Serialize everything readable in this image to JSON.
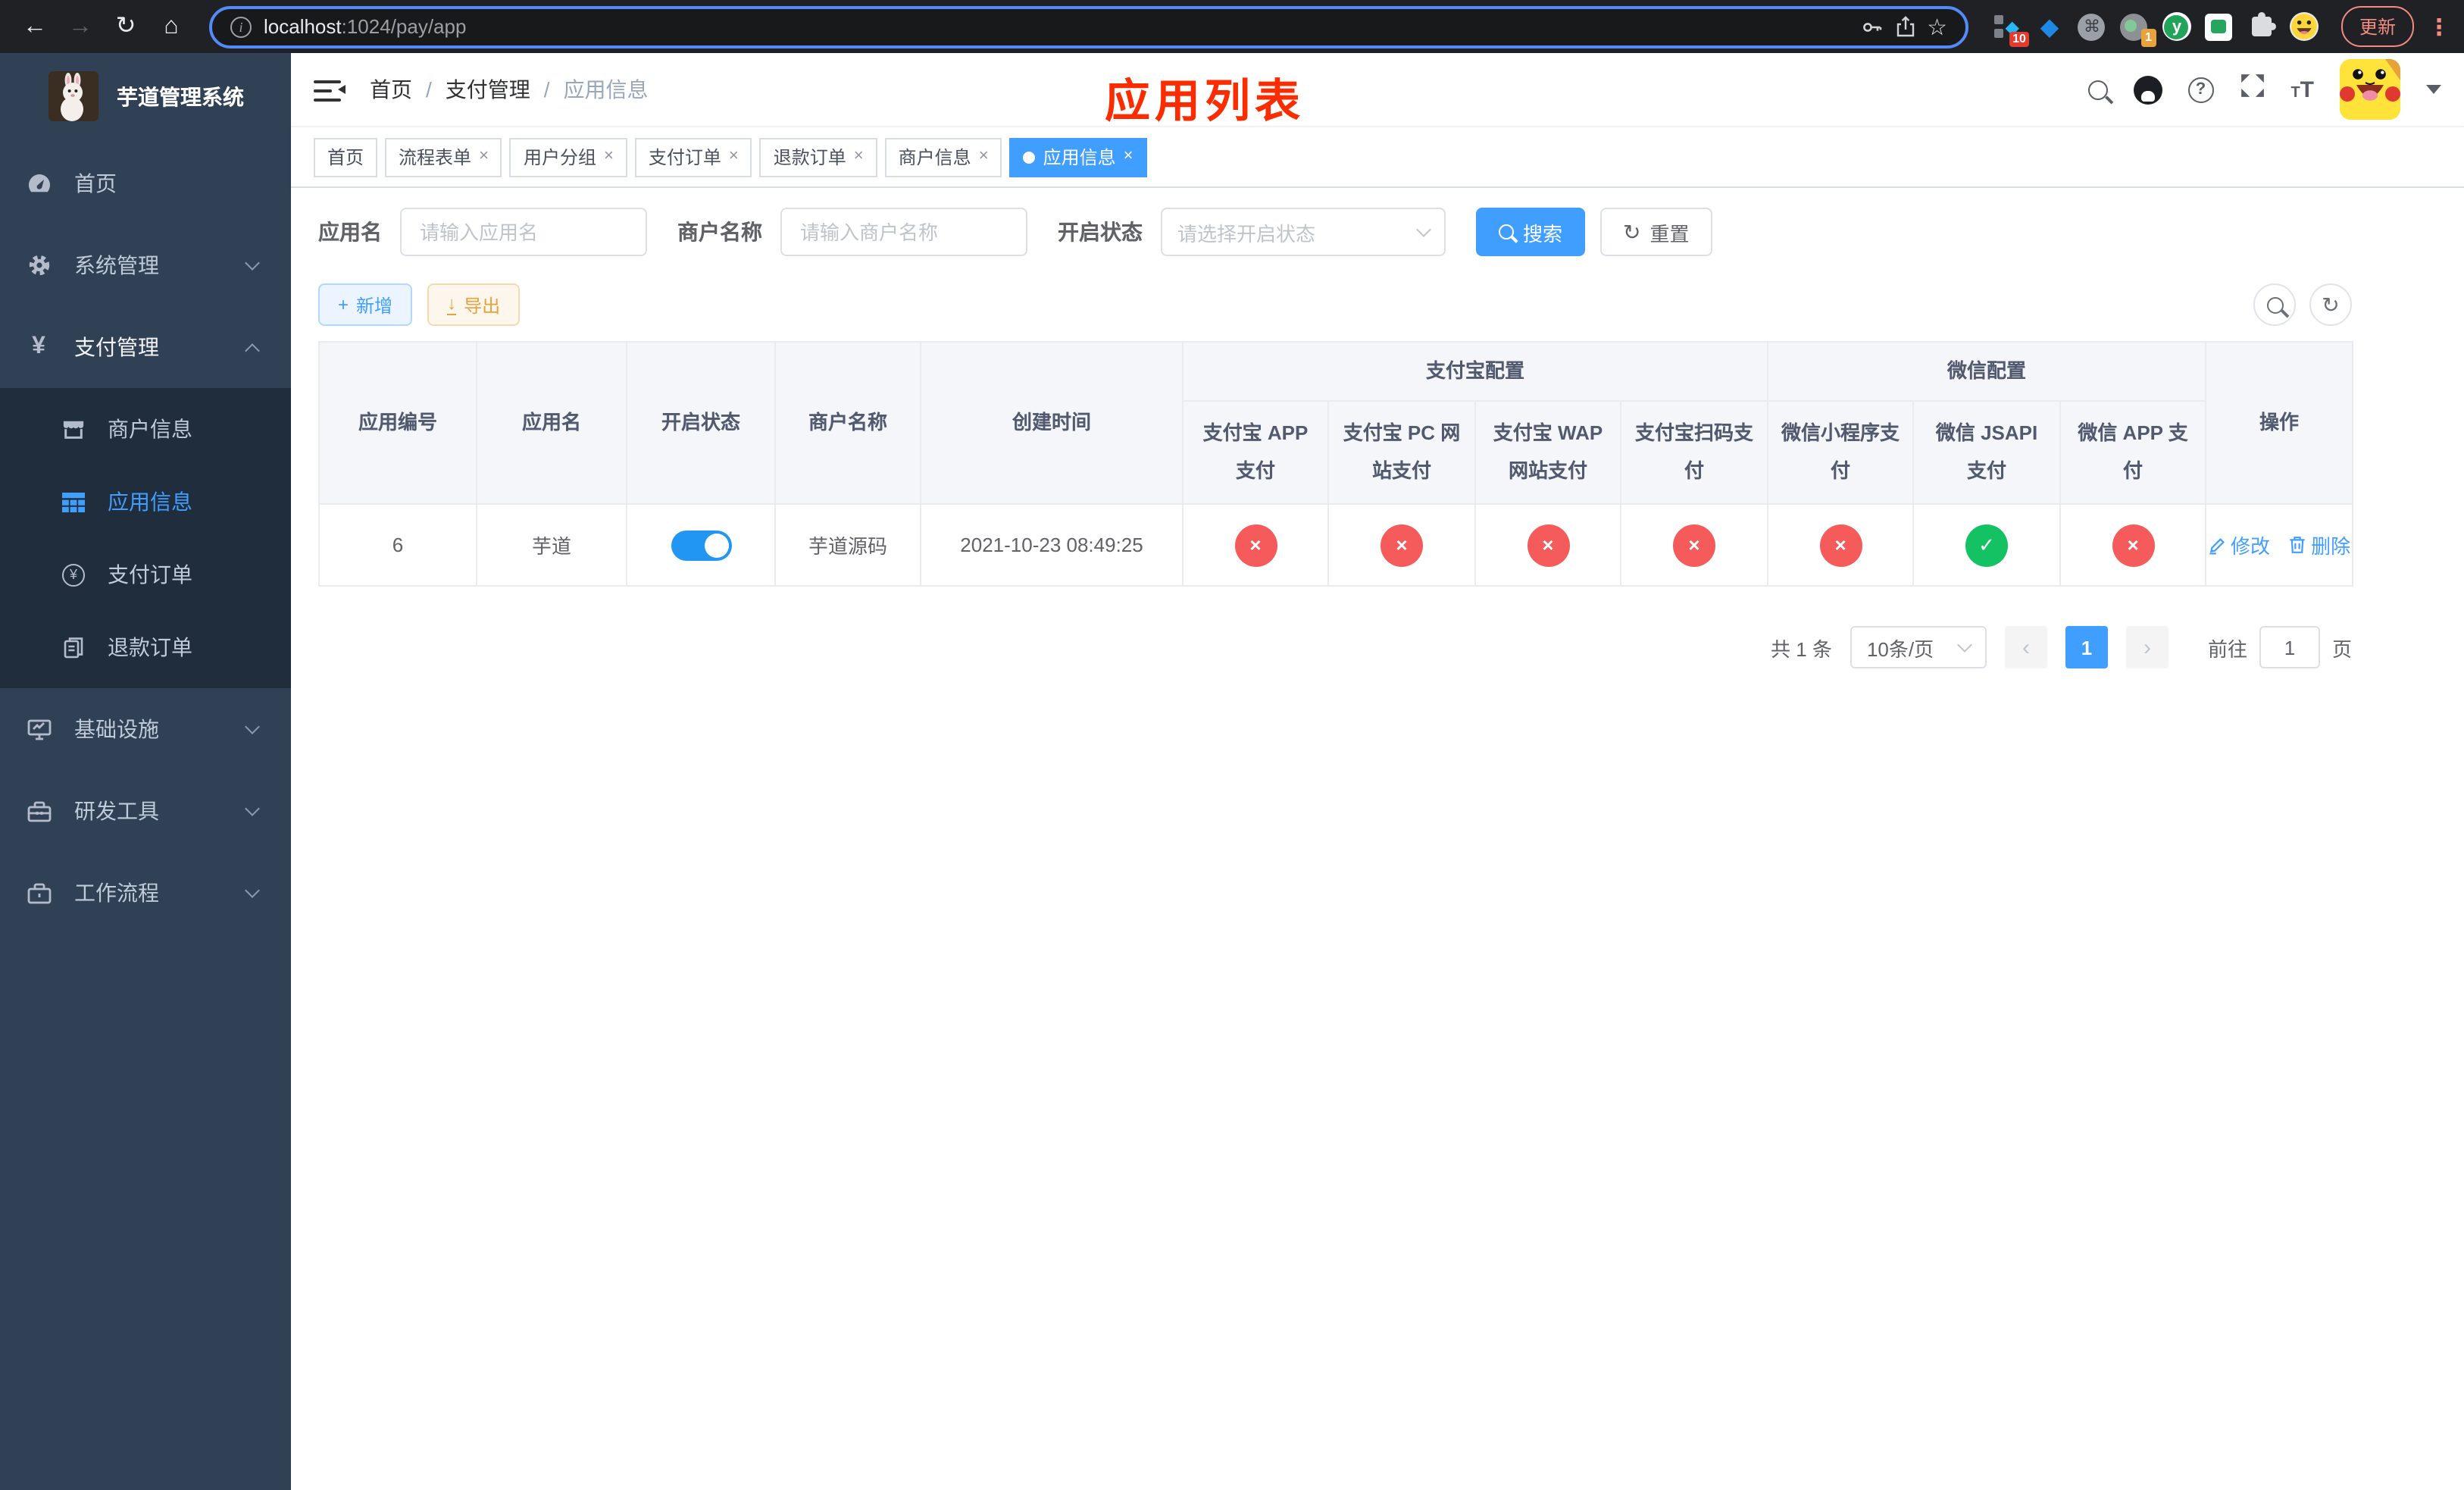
{
  "browser": {
    "url_host": "localhost",
    "url_rest": ":1024/pay/app",
    "update_label": "更新",
    "ext_badge_10": "10",
    "ext_badge_1": "1"
  },
  "sidebar": {
    "title": "芋道管理系统",
    "items": [
      {
        "label": "首页"
      },
      {
        "label": "系统管理"
      },
      {
        "label": "支付管理"
      },
      {
        "label": "基础设施"
      },
      {
        "label": "研发工具"
      },
      {
        "label": "工作流程"
      }
    ],
    "payment_children": [
      {
        "label": "商户信息"
      },
      {
        "label": "应用信息"
      },
      {
        "label": "支付订单"
      },
      {
        "label": "退款订单"
      }
    ]
  },
  "breadcrumb": {
    "items": [
      "首页",
      "支付管理",
      "应用信息"
    ]
  },
  "overlay_title": "应用列表",
  "tabs": {
    "items": [
      {
        "label": "首页",
        "closable": false,
        "active": false
      },
      {
        "label": "流程表单",
        "closable": true,
        "active": false
      },
      {
        "label": "用户分组",
        "closable": true,
        "active": false
      },
      {
        "label": "支付订单",
        "closable": true,
        "active": false
      },
      {
        "label": "退款订单",
        "closable": true,
        "active": false
      },
      {
        "label": "商户信息",
        "closable": true,
        "active": false
      },
      {
        "label": "应用信息",
        "closable": true,
        "active": true
      }
    ],
    "close_glyph": "×"
  },
  "filters": {
    "app_name_label": "应用名",
    "app_name_placeholder": "请输入应用名",
    "merchant_label": "商户名称",
    "merchant_placeholder": "请输入商户名称",
    "status_label": "开启状态",
    "status_placeholder": "请选择开启状态",
    "search_label": "搜索",
    "reset_label": "重置"
  },
  "toolbar": {
    "add_label": "新增",
    "export_label": "导出"
  },
  "table": {
    "columns": [
      "应用编号",
      "应用名",
      "开启状态",
      "商户名称",
      "创建时间"
    ],
    "group_alipay": "支付宝配置",
    "group_wechat": "微信配置",
    "alipay_cols": [
      "支付宝 APP 支付",
      "支付宝 PC 网站支付",
      "支付宝 WAP 网站支付",
      "支付宝扫码支付"
    ],
    "wechat_cols": [
      "微信小程序支付",
      "微信 JSAPI 支付",
      "微信 APP 支付"
    ],
    "op_col": "操作",
    "row": {
      "id": "6",
      "name": "芋道",
      "enabled": true,
      "merchant": "芋道源码",
      "created": "2021-10-23 08:49:25",
      "configs": [
        false,
        false,
        false,
        false,
        false,
        true,
        false
      ],
      "edit_label": "修改",
      "delete_label": "删除"
    }
  },
  "pagination": {
    "total": "共 1 条",
    "page_size": "10条/页",
    "prev_glyph": "‹",
    "page": "1",
    "next_glyph": "›",
    "goto_label": "前往",
    "goto_value": "1",
    "page_unit": "页"
  },
  "colors": {
    "accent": "#409eff",
    "danger": "#f65b5c",
    "success": "#15c263",
    "warning": "#e6a23c",
    "annotation_red": "#fb2d00",
    "sidebar_bg": "#304156",
    "submenu_bg": "#1f2d3d"
  }
}
